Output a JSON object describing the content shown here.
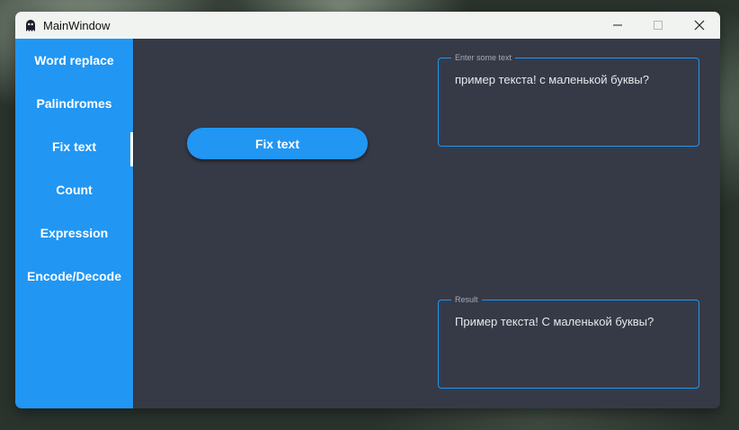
{
  "window": {
    "title": "MainWindow",
    "controls": [
      "minimize-icon",
      "maximize-icon",
      "close-icon"
    ]
  },
  "sidebar": {
    "items": [
      {
        "label": "Word replace",
        "active": false
      },
      {
        "label": "Palindromes",
        "active": false
      },
      {
        "label": "Fix text",
        "active": true
      },
      {
        "label": "Count",
        "active": false
      },
      {
        "label": "Expression",
        "active": false
      },
      {
        "label": "Encode/Decode",
        "active": false
      }
    ]
  },
  "main": {
    "action_button_label": "Fix text",
    "input": {
      "legend": "Enter some text",
      "value": "пример текста! с маленькой буквы?"
    },
    "result": {
      "legend": "Result",
      "value": "Пример текста! С маленькой буквы?"
    }
  },
  "colors": {
    "accent": "#2196f3",
    "content_bg": "#363a47",
    "titlebar_bg": "#f1f3f1"
  }
}
